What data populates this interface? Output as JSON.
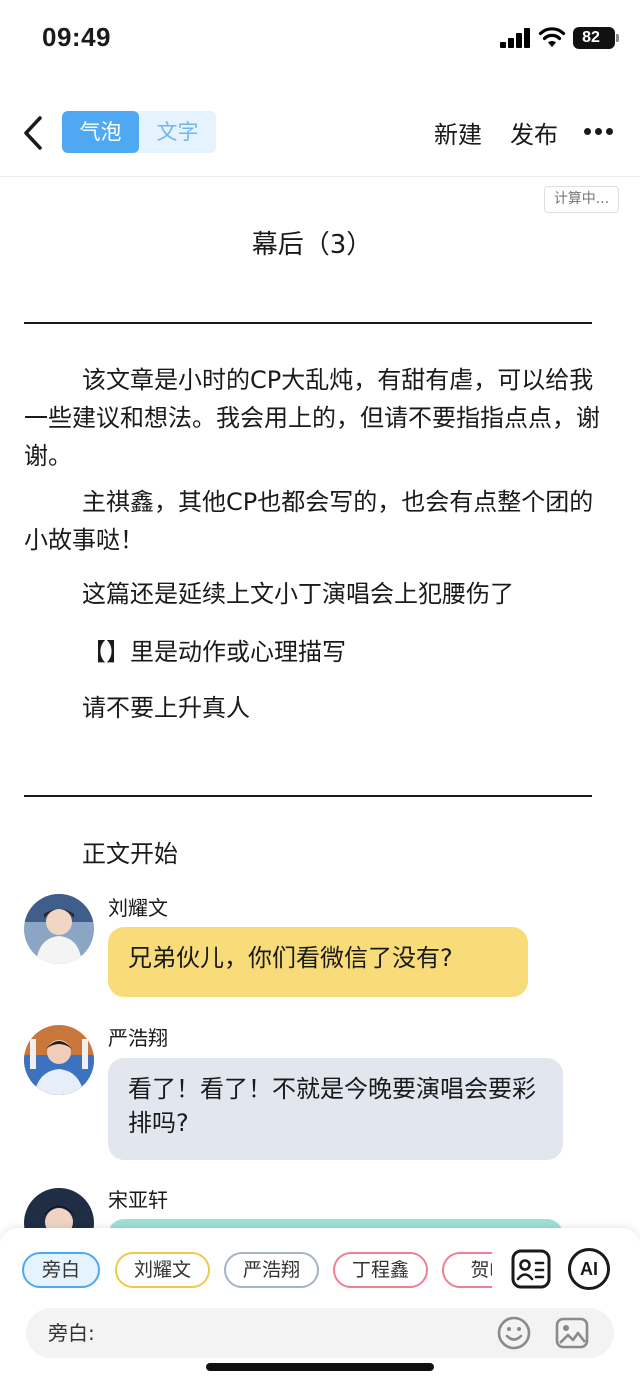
{
  "status_bar": {
    "time": "09:49",
    "battery": "82",
    "icons": [
      "signal-icon",
      "wifi-icon",
      "battery-icon"
    ]
  },
  "nav": {
    "back_icon": "chevron-left-icon",
    "tabs": [
      {
        "label": "气泡",
        "active": true
      },
      {
        "label": "文字",
        "active": false
      }
    ],
    "new_label": "新建",
    "publish_label": "发布",
    "more_icon": "more-horizontal-icon",
    "accent_color": "#4ea9f2"
  },
  "word_counter": "计算中...",
  "document": {
    "title": "幕后（3）",
    "paragraphs": [
      "该文章是小时的CP大乱炖，有甜有虐，可以给我一些建议和想法。我会用上的，但请不要指指点点，谢谢。",
      "主祺鑫，其他CP也都会写的，也会有点整个团的小故事哒！"
    ],
    "lines": [
      "这篇还是延续上文小丁演唱会上犯腰伤了",
      "【】里是动作或心理描写",
      "请不要上升真人"
    ],
    "body_start": "正文开始"
  },
  "chat": [
    {
      "speaker": "刘耀文",
      "text": "兄弟伙儿，你们看微信了没有?",
      "bubble_color": "#f8dc7a"
    },
    {
      "speaker": "严浩翔",
      "text": "看了！看了！不就是今晚要演唱会要彩排吗?",
      "bubble_color": "#e2e6ee"
    },
    {
      "speaker": "宋亚轩",
      "text": "",
      "bubble_color": "#9fe0d6"
    }
  ],
  "bottom": {
    "role_chips": [
      {
        "label": "旁白",
        "color": "#4ea9f2",
        "selected": true
      },
      {
        "label": "刘耀文",
        "color": "#efc94a",
        "selected": false
      },
      {
        "label": "严浩翔",
        "color": "#a5b3c6",
        "selected": false
      },
      {
        "label": "丁程鑫",
        "color": "#ef7f95",
        "selected": false
      },
      {
        "label": "贺峻",
        "color": "#ef7f95",
        "selected": false
      }
    ],
    "tool_icons": [
      "contact-card-icon",
      "ai-icon"
    ],
    "ai_label": "AI",
    "input_label": "旁白:",
    "input_placeholder": "",
    "input_icons": [
      "emoji-icon",
      "image-icon"
    ]
  }
}
